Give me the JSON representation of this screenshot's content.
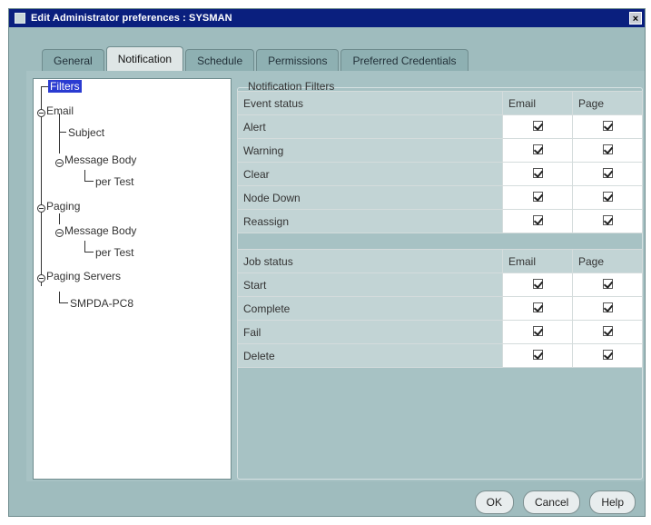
{
  "window": {
    "title": "Edit Administrator preferences : SYSMAN",
    "close_glyph": "×"
  },
  "tabs": [
    {
      "label": "General"
    },
    {
      "label": "Notification"
    },
    {
      "label": "Schedule"
    },
    {
      "label": "Permissions"
    },
    {
      "label": "Preferred Credentials"
    }
  ],
  "tree": {
    "items": [
      {
        "label": "Filters"
      },
      {
        "label": "Email"
      },
      {
        "label": "Subject"
      },
      {
        "label": "Message Body"
      },
      {
        "label": "per Test"
      },
      {
        "label": "Paging"
      },
      {
        "label": "Message Body"
      },
      {
        "label": "per Test"
      },
      {
        "label": "Paging Servers"
      },
      {
        "label": "SMPDA-PC8"
      }
    ]
  },
  "filters": {
    "group_label": "Notification Filters",
    "event_table": {
      "header": {
        "name": "Event status",
        "email": "Email",
        "page": "Page"
      },
      "rows": [
        {
          "name": "Alert",
          "email": true,
          "page": true
        },
        {
          "name": "Warning",
          "email": true,
          "page": true
        },
        {
          "name": "Clear",
          "email": true,
          "page": true
        },
        {
          "name": "Node Down",
          "email": true,
          "page": true
        },
        {
          "name": "Reassign",
          "email": true,
          "page": true
        }
      ]
    },
    "job_table": {
      "header": {
        "name": "Job status",
        "email": "Email",
        "page": "Page"
      },
      "rows": [
        {
          "name": "Start",
          "email": true,
          "page": true
        },
        {
          "name": "Complete",
          "email": true,
          "page": true
        },
        {
          "name": "Fail",
          "email": true,
          "page": true
        },
        {
          "name": "Delete",
          "email": true,
          "page": true
        }
      ]
    }
  },
  "buttons": {
    "ok": "OK",
    "cancel": "Cancel",
    "help": "Help"
  }
}
